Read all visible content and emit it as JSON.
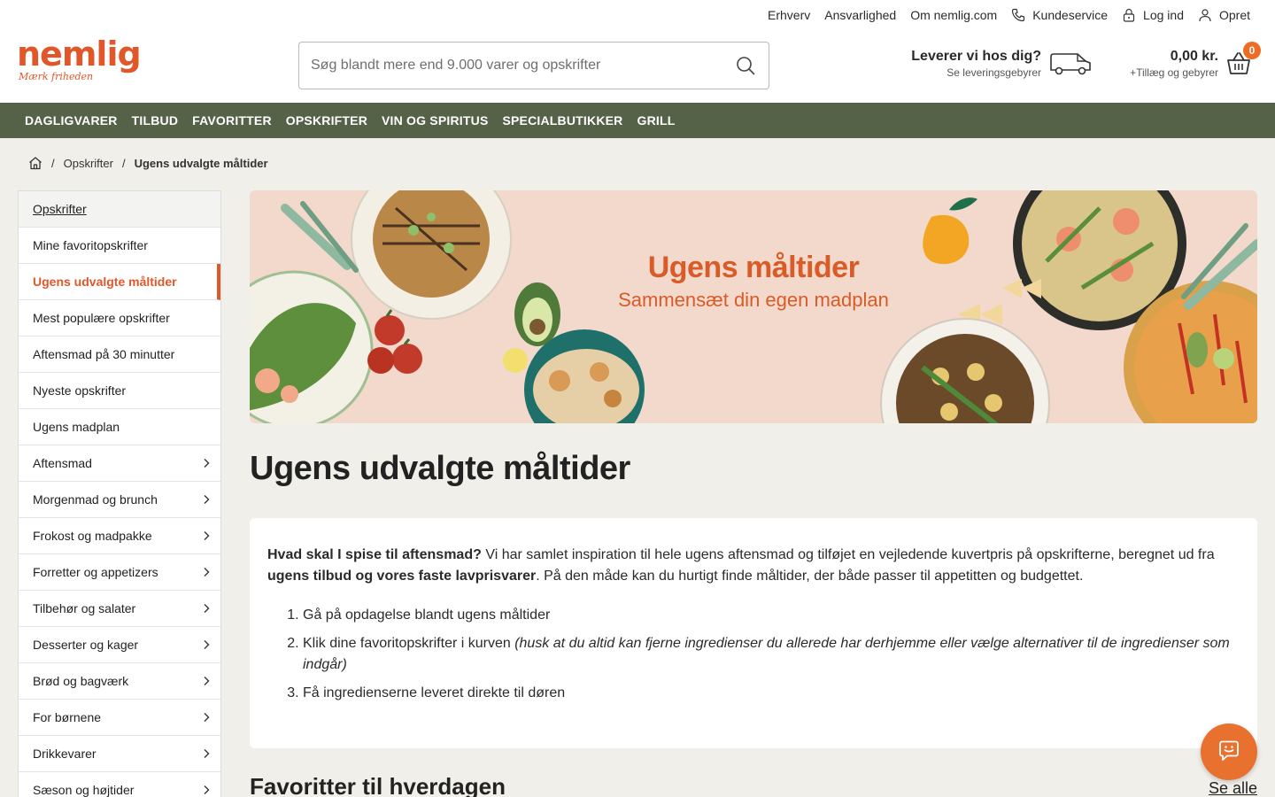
{
  "utility": {
    "links": [
      "Erhverv",
      "Ansvarlighed",
      "Om nemlig.com"
    ],
    "customer_service": "Kundeservice",
    "login": "Log ind",
    "register": "Opret"
  },
  "logo": {
    "brand": "nemlig",
    "tagline": "Mærk friheden"
  },
  "search": {
    "placeholder": "Søg blandt mere end 9.000 varer og opskrifter"
  },
  "delivery": {
    "title": "Leverer vi hos dig?",
    "subtitle": "Se leveringsgebyrer"
  },
  "cart": {
    "amount": "0,00 kr.",
    "subtitle": "+Tillæg og gebyrer",
    "count": "0"
  },
  "nav": [
    "DAGLIGVARER",
    "TILBUD",
    "FAVORITTER",
    "OPSKRIFTER",
    "VIN OG SPIRITUS",
    "SPECIALBUTIKKER",
    "GRILL"
  ],
  "breadcrumb": {
    "parent": "Opskrifter",
    "current": "Ugens udvalgte måltider"
  },
  "sidebar": {
    "header": "Opskrifter",
    "items": [
      {
        "label": "Mine favoritopskrifter",
        "chevron": false
      },
      {
        "label": "Ugens udvalgte måltider",
        "chevron": false,
        "active": true
      },
      {
        "label": "Mest populære opskrifter",
        "chevron": false
      },
      {
        "label": "Aftensmad på 30 minutter",
        "chevron": false
      },
      {
        "label": "Nyeste opskrifter",
        "chevron": false
      },
      {
        "label": "Ugens madplan",
        "chevron": false
      },
      {
        "label": "Aftensmad",
        "chevron": true
      },
      {
        "label": "Morgenmad og brunch",
        "chevron": true
      },
      {
        "label": "Frokost og madpakke",
        "chevron": true
      },
      {
        "label": "Forretter og appetizers",
        "chevron": true
      },
      {
        "label": "Tilbehør og salater",
        "chevron": true
      },
      {
        "label": "Desserter og kager",
        "chevron": true
      },
      {
        "label": "Brød og bagværk",
        "chevron": true
      },
      {
        "label": "For børnene",
        "chevron": true
      },
      {
        "label": "Drikkevarer",
        "chevron": true
      },
      {
        "label": "Sæson og højtider",
        "chevron": true
      }
    ]
  },
  "banner": {
    "title": "Ugens måltider",
    "subtitle": "Sammensæt din egen madplan"
  },
  "page": {
    "title": "Ugens udvalgte måltider",
    "intro_bold1": "Hvad skal I spise til aftensmad?",
    "intro_text1": " Vi har samlet inspiration til hele ugens aftensmad og tilføjet en vejledende kuvertpris på opskrifterne, beregnet ud fra ",
    "intro_bold2": "ugens tilbud og vores faste lavprisvarer",
    "intro_text2": ". På den måde kan du hurtigt finde måltider, der både passer til appetitten og budgettet.",
    "step1": "Gå på opdagelse blandt ugens måltider",
    "step2": "Klik dine favoritopskrifter i kurven ",
    "step2_note": "(husk at du altid kan fjerne ingredienser du allerede har derhjemme eller vælge alternativer til de ingredienser som indgår)",
    "step3": "Få ingredienserne leveret direkte til døren"
  },
  "section": {
    "title": "Favoritter til hverdagen",
    "see_all": "Se alle"
  },
  "colors": {
    "brand_orange": "#e0572a",
    "nav_green": "#566248",
    "banner_bg": "#f2d9cc"
  }
}
